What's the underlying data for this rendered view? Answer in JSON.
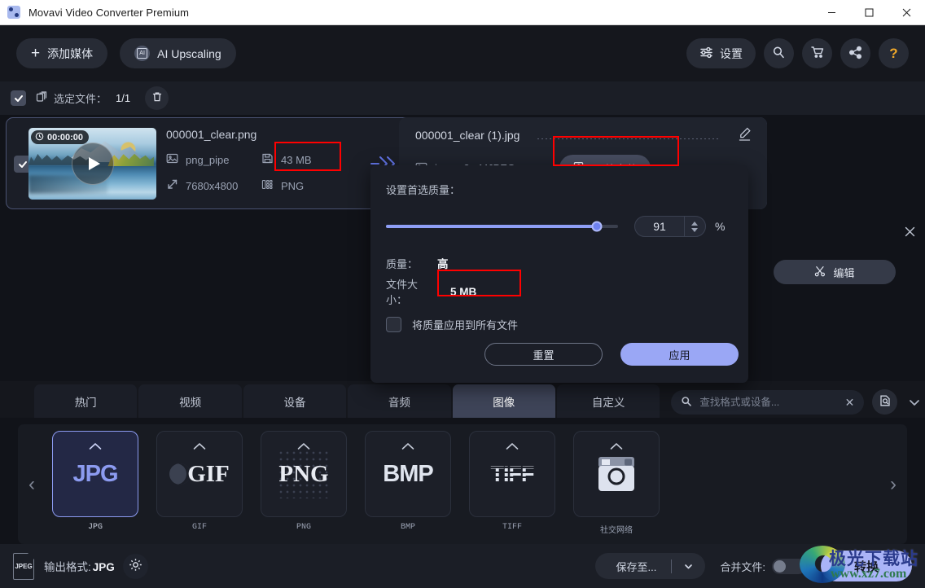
{
  "window": {
    "title": "Movavi Video Converter Premium",
    "minimize": "—",
    "maximize": "◻",
    "close": "✕"
  },
  "toolbar": {
    "add_media": "添加媒体",
    "ai_upscaling": "AI Upscaling",
    "settings": "设置",
    "search_icon": "search-icon",
    "cart_icon": "cart-icon",
    "share_icon": "share-icon",
    "help_icon": "help-icon"
  },
  "selection_bar": {
    "label": "选定文件：",
    "count": "1/1",
    "delete_icon": "trash-icon"
  },
  "file_card": {
    "duration": "00:00:00",
    "name": "000001_clear.png",
    "source_label": "png_pipe",
    "size": "43 MB",
    "resolution": "7680x4800",
    "format": "PNG"
  },
  "output_card": {
    "name": "000001_clear (1).jpg",
    "codec": "image2 · MJPEG",
    "compress_label": "压缩文件",
    "edit_label": "编辑",
    "edit_pencil_icon": "pencil-icon",
    "close_icon": "close-icon"
  },
  "popup": {
    "title": "设置首选质量：",
    "slider_value": 91,
    "slider_min": 0,
    "slider_max": 100,
    "percent_symbol": "%",
    "quality_key": "质量：",
    "quality_value": "高",
    "filesize_key": "文件大小：",
    "filesize_value": "5 MB",
    "apply_all_label": "将质量应用到所有文件",
    "apply_all_checked": false,
    "reset_label": "重置",
    "apply_label": "应用"
  },
  "tabs": [
    {
      "label": "热门",
      "active": false
    },
    {
      "label": "视频",
      "active": false
    },
    {
      "label": "设备",
      "active": false
    },
    {
      "label": "音频",
      "active": false
    },
    {
      "label": "图像",
      "active": true
    },
    {
      "label": "自定义",
      "active": false
    }
  ],
  "search": {
    "value": "",
    "placeholder": "查找格式或设备...",
    "clear": "✕",
    "search_icon": "search-icon",
    "preview_icon": "file-search-icon"
  },
  "formats": {
    "prev_arrow": "‹",
    "next_arrow": "›",
    "items": [
      {
        "logo": "JPG",
        "caption": "JPG",
        "selected": true
      },
      {
        "logo": "GIF",
        "caption": "GIF",
        "selected": false
      },
      {
        "logo": "PNG",
        "caption": "PNG",
        "selected": false
      },
      {
        "logo": "BMP",
        "caption": "BMP",
        "selected": false
      },
      {
        "logo": "TIFF",
        "caption": "TIFF",
        "selected": false
      },
      {
        "logo": "",
        "caption": "社交网络",
        "selected": false
      }
    ]
  },
  "bottom": {
    "file_icon_text": "JPEG",
    "output_format_label": "输出格式:",
    "output_format_value": "JPG",
    "gear_icon": "gear-icon",
    "save_to": "保存至...",
    "save_to_caret": "⌄",
    "merge_label": "合并文件:",
    "merge_enabled": false,
    "convert": "转换"
  },
  "watermark": {
    "line1": "极光下载站",
    "line2": "www.xz7.com"
  },
  "colors": {
    "accent": "#8c9bf0",
    "apply_button": "#9aa7f5",
    "highlight_box": "#ff0000",
    "app_bg": "#111319",
    "panel_bg": "#1b1e27"
  }
}
